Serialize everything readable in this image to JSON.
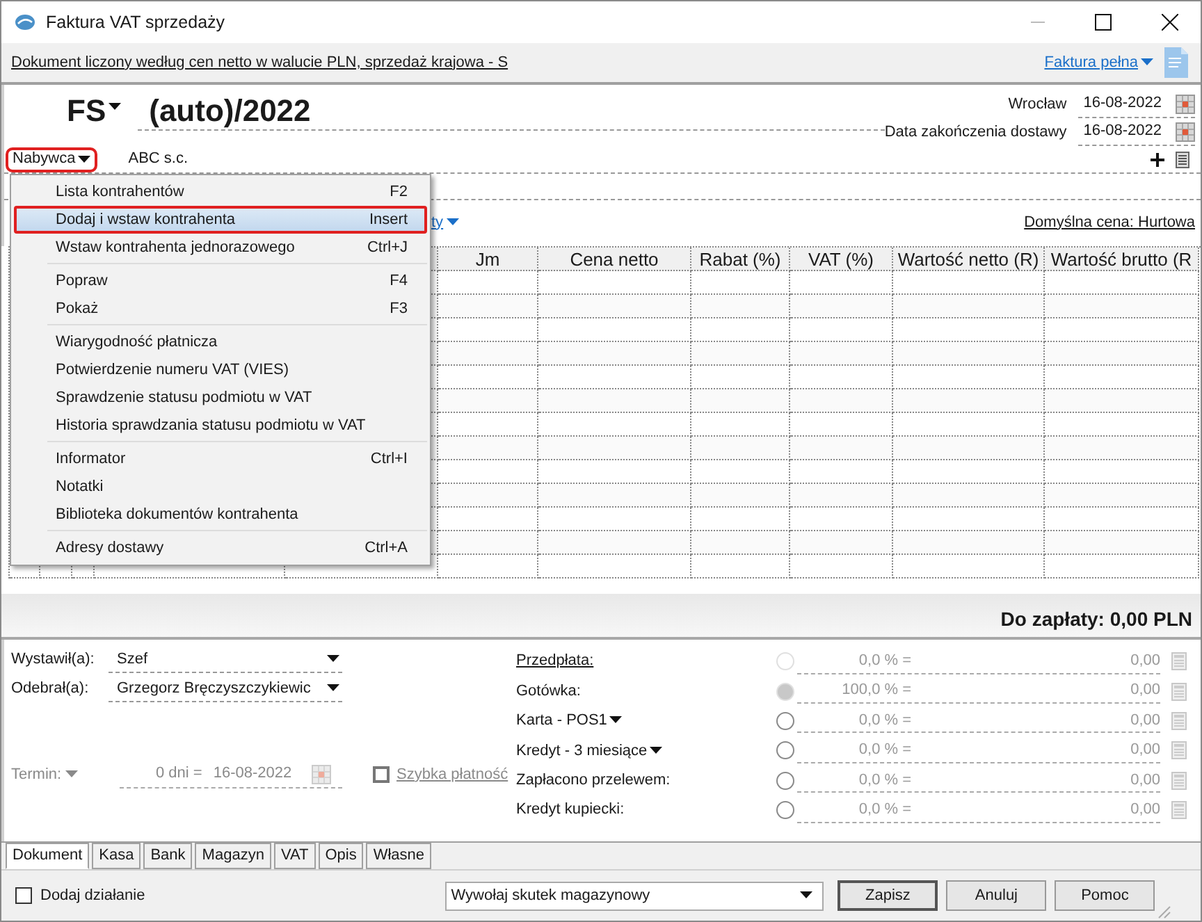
{
  "window": {
    "title": "Faktura VAT sprzedaży"
  },
  "info_bar": {
    "description": "Dokument liczony według cen netto w walucie PLN, sprzedaż krajowa - S",
    "document_type": "Faktura pełna"
  },
  "header": {
    "series": "FS",
    "number": "(auto)/2022",
    "place": "Wrocław",
    "issue_date": "16-08-2022",
    "delivery_label": "Data zakończenia dostawy",
    "delivery_date": "16-08-2022"
  },
  "buyer": {
    "label": "Nabywca",
    "name": "ABC s.c."
  },
  "price_link": "ty",
  "default_price": "Domyślna cena: Hurtowa",
  "table": {
    "columns": [
      "Jm",
      "Cena netto",
      "Rabat (%)",
      "VAT (%)",
      "Wartość netto (R)",
      "Wartość brutto (R"
    ]
  },
  "total": "Do zapłaty: 0,00 PLN",
  "menu": {
    "groups": [
      [
        {
          "label": "Lista kontrahentów",
          "shortcut": "F2",
          "selected": false
        },
        {
          "label": "Dodaj i wstaw kontrahenta",
          "shortcut": "Insert",
          "selected": true
        },
        {
          "label": "Wstaw kontrahenta jednorazowego",
          "shortcut": "Ctrl+J",
          "selected": false
        }
      ],
      [
        {
          "label": "Popraw",
          "shortcut": "F4",
          "selected": false
        },
        {
          "label": "Pokaż",
          "shortcut": "F3",
          "selected": false
        }
      ],
      [
        {
          "label": "Wiarygodność płatnicza",
          "selected": false
        },
        {
          "label": "Potwierdzenie numeru VAT (VIES)",
          "selected": false
        },
        {
          "label": "Sprawdzenie statusu podmiotu w VAT",
          "selected": false
        },
        {
          "label": "Historia sprawdzania statusu podmiotu w VAT",
          "selected": false
        }
      ],
      [
        {
          "label": "Informator",
          "shortcut": "Ctrl+I",
          "selected": false
        },
        {
          "label": "Notatki",
          "selected": false
        },
        {
          "label": "Biblioteka dokumentów kontrahenta",
          "selected": false
        }
      ],
      [
        {
          "label": "Adresy dostawy",
          "shortcut": "Ctrl+A",
          "selected": false
        }
      ]
    ]
  },
  "issued_by": {
    "label": "Wystawił(a):",
    "value": "Szef"
  },
  "received_by": {
    "label": "Odebrał(a):",
    "value": "Grzegorz Bręczyszczykiewic"
  },
  "term": {
    "label": "Termin:",
    "days": "0 dni =",
    "date": "16-08-2022"
  },
  "quick_payment": {
    "label": "Szybka płatność",
    "checked": false
  },
  "payments": [
    {
      "label": "Przedpłata:",
      "kind": "link",
      "selected": false,
      "disabled": true,
      "percent": "0,0 % =",
      "value": "0,00"
    },
    {
      "label": "Gotówka:",
      "kind": "text",
      "selected": true,
      "disabled": true,
      "percent": "100,0 % =",
      "value": "0,00"
    },
    {
      "label": "Karta - POS1",
      "kind": "dropdown",
      "selected": false,
      "disabled": false,
      "percent": "0,0 % =",
      "value": "0,00"
    },
    {
      "label": "Kredyt - 3 miesiące",
      "kind": "dropdown",
      "selected": false,
      "disabled": false,
      "percent": "0,0 % =",
      "value": "0,00"
    },
    {
      "label": "Zapłacono przelewem:",
      "kind": "text",
      "selected": false,
      "disabled": false,
      "percent": "0,0 % =",
      "value": "0,00"
    },
    {
      "label": "Kredyt kupiecki:",
      "kind": "text",
      "selected": false,
      "disabled": false,
      "percent": "0,0 % =",
      "value": "0,00"
    }
  ],
  "tabs": [
    {
      "label": "Dokument",
      "selected": true
    },
    {
      "label": "Kasa",
      "selected": false
    },
    {
      "label": "Bank",
      "selected": false
    },
    {
      "label": "Magazyn",
      "selected": false
    },
    {
      "label": "VAT",
      "selected": false
    },
    {
      "label": "Opis",
      "selected": false
    },
    {
      "label": "Własne",
      "selected": false
    }
  ],
  "add_action": {
    "label": "Dodaj działanie",
    "checked": false
  },
  "stock_effect": "Wywołaj skutek magazynowy",
  "buttons": [
    "Zapisz",
    "Anuluj",
    "Pomoc"
  ]
}
